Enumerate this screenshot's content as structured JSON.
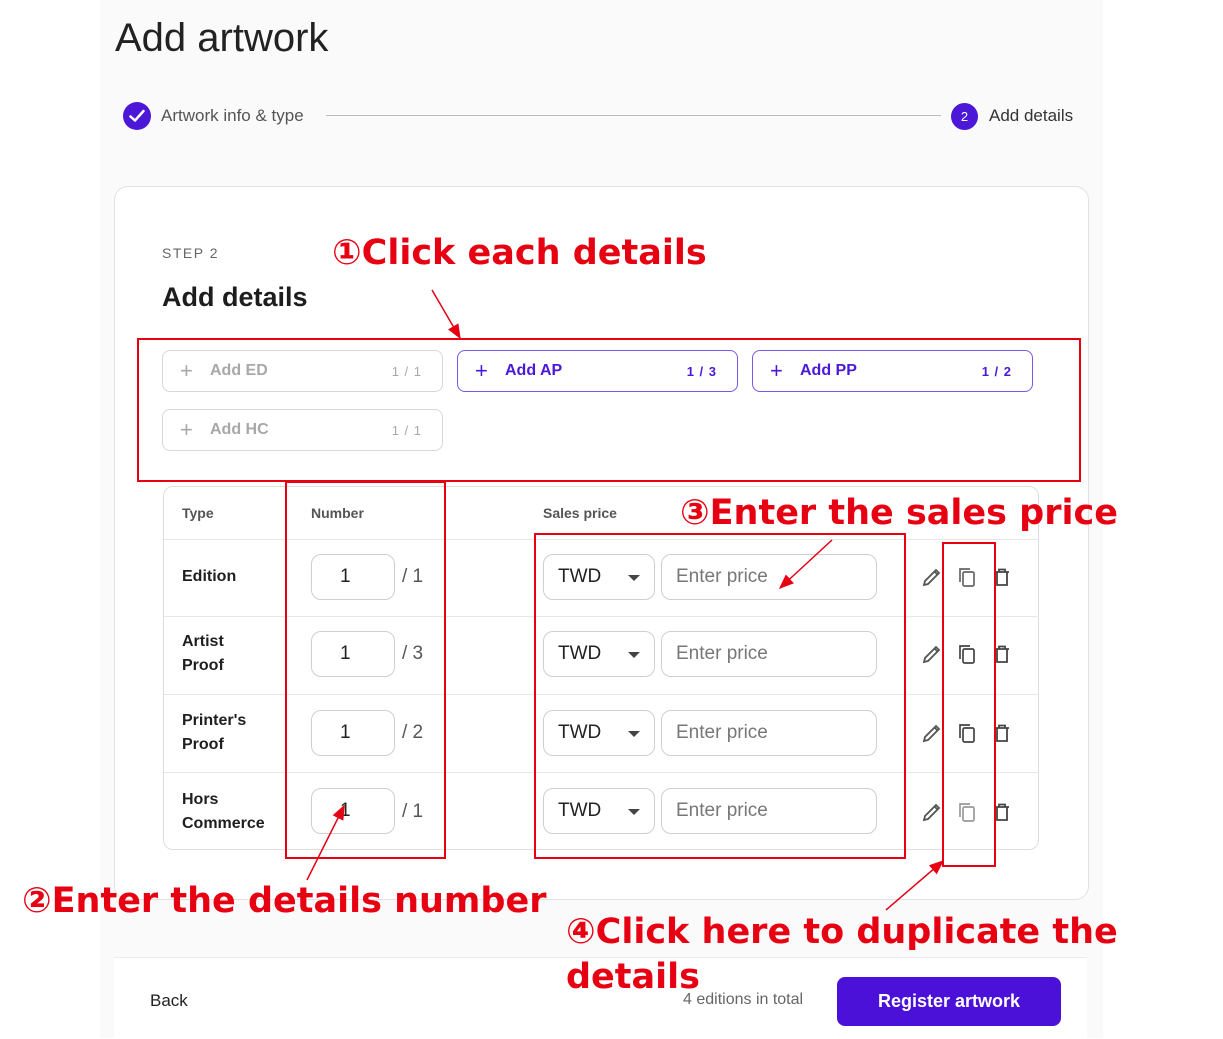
{
  "page": {
    "title": "Add artwork"
  },
  "stepper": {
    "step1_label": "Artwork info & type",
    "step2_number": "2",
    "step2_label": "Add details"
  },
  "card": {
    "step_tag": "STEP 2",
    "title": "Add details",
    "add_buttons": [
      {
        "label": "Add ED",
        "count": "1 / 1",
        "state": "disabled"
      },
      {
        "label": "Add AP",
        "count": "1 / 3",
        "state": "active"
      },
      {
        "label": "Add PP",
        "count": "1 / 2",
        "state": "active"
      },
      {
        "label": "Add HC",
        "count": "1 / 1",
        "state": "disabled"
      }
    ]
  },
  "table": {
    "headers": {
      "type": "Type",
      "number": "Number",
      "sales_price": "Sales price"
    },
    "rows": [
      {
        "type_line1": "Edition",
        "type_line2": "",
        "number": "1",
        "total": "/ 1",
        "currency": "TWD",
        "price_placeholder": "Enter price"
      },
      {
        "type_line1": "Artist",
        "type_line2": "Proof",
        "number": "1",
        "total": "/ 3",
        "currency": "TWD",
        "price_placeholder": "Enter price"
      },
      {
        "type_line1": "Printer's",
        "type_line2": "Proof",
        "number": "1",
        "total": "/ 2",
        "currency": "TWD",
        "price_placeholder": "Enter price"
      },
      {
        "type_line1": "Hors",
        "type_line2": "Commerce",
        "number": "1",
        "total": "/ 1",
        "currency": "TWD",
        "price_placeholder": "Enter price"
      }
    ]
  },
  "footer": {
    "back_label": "Back",
    "total_text": "4 editions in total",
    "register_label": "Register artwork"
  },
  "annotations": {
    "a1": "①Click each details",
    "a2": "②Enter the details number",
    "a3": "③Enter the sales price",
    "a4_line1": "④Click here to duplicate the",
    "a4_line2": "details"
  },
  "colors": {
    "accent": "#4b18d8",
    "annotation": "#e60012"
  }
}
